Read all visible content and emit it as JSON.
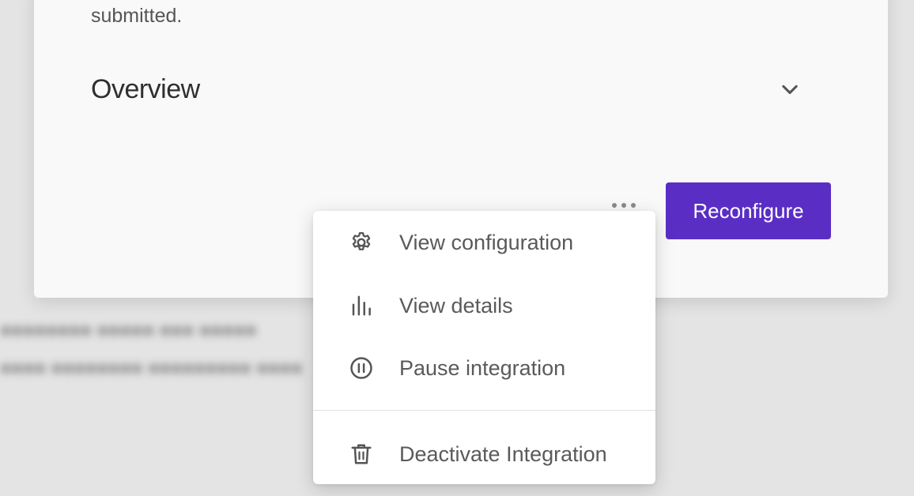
{
  "card": {
    "partial_text": "submitted.",
    "section_title": "Overview",
    "section_toggle_icon": "chevron-down-icon",
    "more_icon": "more-horizontal-icon",
    "primary_button": "Reconfigure"
  },
  "menu": {
    "items": [
      {
        "label": "View configuration",
        "icon": "gear-icon"
      },
      {
        "label": "View details",
        "icon": "bar-chart-icon"
      },
      {
        "label": "Pause integration",
        "icon": "pause-circle-icon"
      },
      {
        "label": "Deactivate Integration",
        "icon": "trash-icon"
      }
    ]
  },
  "colors": {
    "primary_button": "#5a2ec5",
    "backdrop": "#e4e4e4",
    "card": "#f9f9f9"
  }
}
